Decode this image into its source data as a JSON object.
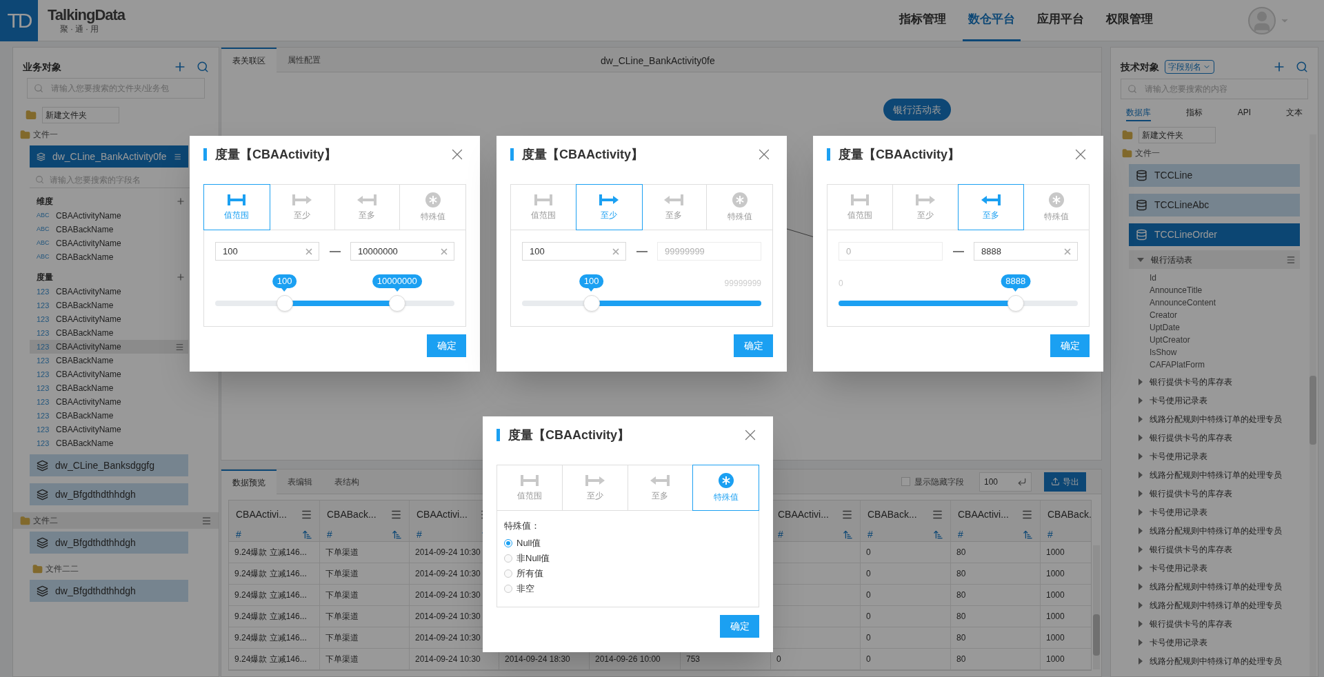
{
  "header": {
    "logo_mark": "TD",
    "brand": "TalkingData",
    "slogan": "聚·通·用",
    "nav": [
      {
        "label": "指标管理",
        "selected": false
      },
      {
        "label": "数仓平台",
        "selected": true
      },
      {
        "label": "应用平台",
        "selected": false
      },
      {
        "label": "权限管理",
        "selected": false
      }
    ]
  },
  "left_panel": {
    "title": "业务对象",
    "search": {
      "placeholder": "请输入您要搜索的文件夹/业务包"
    },
    "new_folder": {
      "value": "新建文件夹"
    },
    "folders": [
      {
        "name": "文件一",
        "hovered": false,
        "packages": [
          {
            "name": "dw_CLine_BankActivity0fe",
            "selected": true,
            "field_search": {
              "placeholder": "请输入您要搜索的字段名"
            },
            "groups": [
              {
                "title": "维度",
                "fields": [
                  {
                    "type": "ABC",
                    "name": "CBAActivityName",
                    "hovered": false
                  },
                  {
                    "type": "ABC",
                    "name": "CBABackName",
                    "hovered": false
                  },
                  {
                    "type": "ABC",
                    "name": "CBAActivityName",
                    "hovered": false
                  },
                  {
                    "type": "ABC",
                    "name": "CBABackName",
                    "hovered": false
                  }
                ]
              },
              {
                "title": "度量",
                "fields": [
                  {
                    "type": "123",
                    "name": "CBAActivityName",
                    "hovered": false
                  },
                  {
                    "type": "123",
                    "name": "CBABackName",
                    "hovered": false
                  },
                  {
                    "type": "123",
                    "name": "CBAActivityName",
                    "hovered": false
                  },
                  {
                    "type": "123",
                    "name": "CBABackName",
                    "hovered": false
                  },
                  {
                    "type": "123",
                    "name": "CBAActivityName",
                    "hovered": true
                  },
                  {
                    "type": "123",
                    "name": "CBABackName",
                    "hovered": false
                  },
                  {
                    "type": "123",
                    "name": "CBAActivityName",
                    "hovered": false
                  },
                  {
                    "type": "123",
                    "name": "CBABackName",
                    "hovered": false
                  },
                  {
                    "type": "123",
                    "name": "CBAActivityName",
                    "hovered": false
                  },
                  {
                    "type": "123",
                    "name": "CBABackName",
                    "hovered": false
                  },
                  {
                    "type": "123",
                    "name": "CBAActivityName",
                    "hovered": false
                  },
                  {
                    "type": "123",
                    "name": "CBABackName",
                    "hovered": false
                  }
                ]
              }
            ]
          },
          {
            "name": "dw_CLine_Banksdggfg",
            "selected": false
          },
          {
            "name": "dw_Bfgdthdthhdgh",
            "selected": false
          }
        ]
      },
      {
        "name": "文件二",
        "hovered": true,
        "packages": [
          {
            "name": "dw_Bfgdthdthhdgh",
            "selected": false
          }
        ],
        "children": [
          {
            "name": "文件二二",
            "hovered": false,
            "packages": [
              {
                "name": "dw_Bfgdthdthhdgh",
                "selected": false
              }
            ]
          }
        ]
      }
    ]
  },
  "center": {
    "tabs": [
      {
        "label": "表关联区",
        "selected": true
      },
      {
        "label": "属性配置",
        "selected": false
      }
    ],
    "title": "dw_CLine_BankActivity0fe",
    "nodes": [
      {
        "label": "银行活动表"
      }
    ]
  },
  "preview": {
    "tabs": [
      {
        "label": "数据预览",
        "selected": true
      },
      {
        "label": "表编辑",
        "selected": false
      },
      {
        "label": "表结构",
        "selected": false
      }
    ],
    "show_hidden": {
      "label": "显示隐藏字段",
      "checked": false
    },
    "row_count": "100",
    "export": "导出",
    "columns": [
      {
        "name": "CBAActivi...",
        "type": "#"
      },
      {
        "name": "CBABack...",
        "type": "#"
      },
      {
        "name": "CBAActivi...",
        "type": "#"
      },
      {},
      {},
      {},
      {
        "name": "CBAActivi...",
        "type": "#"
      },
      {
        "name": "CBABack...",
        "type": "#"
      },
      {
        "name": "CBAActivi...",
        "type": "#"
      },
      {
        "name": "CBABack.",
        "type": "#"
      }
    ],
    "rows": [
      [
        "9.24爆款 立减146...",
        "下单渠道",
        "2014-09-24 10:30",
        null,
        null,
        null,
        null,
        "0",
        "80",
        "1000"
      ],
      [
        "9.24爆款 立减146...",
        "下单渠道",
        "2014-09-24 10:30",
        null,
        null,
        null,
        null,
        "0",
        "80",
        "1000"
      ],
      [
        "9.24爆款 立减146...",
        "下单渠道",
        "2014-09-24 10:30",
        null,
        null,
        null,
        null,
        "0",
        "80",
        "1000"
      ],
      [
        "9.24爆款 立减146...",
        "下单渠道",
        "2014-09-24 10:30",
        null,
        null,
        null,
        null,
        "0",
        "80",
        "1000"
      ],
      [
        "9.24爆款 立减146...",
        "下单渠道",
        "2014-09-24 10:30",
        null,
        null,
        null,
        null,
        "0",
        "80",
        "1000"
      ],
      [
        "9.24爆款 立减146...",
        "下单渠道",
        "2014-09-24 10:30",
        "2014-09-24 18:30",
        "2014-09-26 10:00",
        "753",
        "0",
        "0",
        "80",
        "1000"
      ]
    ]
  },
  "right_panel": {
    "title": "技术对象",
    "alias_dropdown": "字段别名",
    "search": {
      "placeholder": "请输入您要搜索的内容"
    },
    "tabs": [
      {
        "label": "数据库",
        "selected": true
      },
      {
        "label": "指标",
        "selected": false
      },
      {
        "label": "API",
        "selected": false
      },
      {
        "label": "文本",
        "selected": false
      }
    ],
    "new_folder": {
      "value": "新建文件夹"
    },
    "folder": "文件一",
    "tables": [
      {
        "name": "TCCLine",
        "selected": false
      },
      {
        "name": "TCCLineAbc",
        "selected": false
      },
      {
        "name": "TCCLineOrder",
        "selected": true,
        "children": [
          {
            "name": "银行活动表",
            "expanded": true,
            "children": [
              {
                "name": "Id"
              },
              {
                "name": "AnnounceTitle"
              },
              {
                "name": "AnnounceContent"
              },
              {
                "name": "Creator"
              },
              {
                "name": "UptDate"
              },
              {
                "name": "UptCreator"
              },
              {
                "name": "IsShow"
              },
              {
                "name": "CAFAPlatForm"
              }
            ]
          },
          {
            "name": "银行提供卡号的库存表",
            "expanded": false
          },
          {
            "name": "卡号使用记录表",
            "expanded": false
          },
          {
            "name": "线路分配规则中特殊订单的处理专员",
            "expanded": false
          },
          {
            "name": "银行提供卡号的库存表",
            "expanded": false
          },
          {
            "name": "卡号使用记录表",
            "expanded": false
          },
          {
            "name": "线路分配规则中特殊订单的处理专员",
            "expanded": false
          },
          {
            "name": "银行提供卡号的库存表",
            "expanded": false
          },
          {
            "name": "卡号使用记录表",
            "expanded": false
          },
          {
            "name": "线路分配规则中特殊订单的处理专员",
            "expanded": false
          },
          {
            "name": "银行提供卡号的库存表",
            "expanded": false
          },
          {
            "name": "卡号使用记录表",
            "expanded": false
          },
          {
            "name": "线路分配规则中特殊订单的处理专员",
            "expanded": false
          },
          {
            "name": "线路分配规则中特殊订单的处理专员",
            "expanded": false
          },
          {
            "name": "银行提供卡号的库存表",
            "expanded": false
          },
          {
            "name": "卡号使用记录表",
            "expanded": false
          },
          {
            "name": "线路分配规则中特殊订单的处理专员",
            "expanded": false
          }
        ]
      }
    ]
  },
  "dialogs": [
    {
      "title": "度量【CBAActivity】",
      "kind": "range",
      "tabs": [
        {
          "kind": "range",
          "label": "值范围",
          "selected": true
        },
        {
          "kind": "min",
          "label": "至少",
          "selected": false
        },
        {
          "kind": "max",
          "label": "至多",
          "selected": false
        },
        {
          "kind": "special",
          "label": "特殊值",
          "selected": false
        }
      ],
      "inputs": [
        {
          "value": "100",
          "disabled": false
        },
        {
          "value": "10000000",
          "disabled": false
        }
      ],
      "handles": [
        {
          "level": 0.29,
          "reading": "100"
        },
        {
          "level": 0.76,
          "reading": "10000000"
        }
      ],
      "confirm": "确定"
    },
    {
      "title": "度量【CBAActivity】",
      "kind": "min",
      "tabs": [
        {
          "kind": "range",
          "label": "值范围",
          "selected": false
        },
        {
          "kind": "min",
          "label": "至少",
          "selected": true
        },
        {
          "kind": "max",
          "label": "至多",
          "selected": false
        },
        {
          "kind": "special",
          "label": "特殊值",
          "selected": false
        }
      ],
      "inputs": [
        {
          "value": "100",
          "disabled": false
        },
        {
          "placeholder": "99999999",
          "disabled": true
        }
      ],
      "handles": [
        {
          "level": 0.29,
          "reading": "100"
        }
      ],
      "end_label": "99999999",
      "confirm": "确定"
    },
    {
      "title": "度量【CBAActivity】",
      "kind": "max",
      "tabs": [
        {
          "kind": "range",
          "label": "值范围",
          "selected": false
        },
        {
          "kind": "min",
          "label": "至少",
          "selected": false
        },
        {
          "kind": "max",
          "label": "至多",
          "selected": true
        },
        {
          "kind": "special",
          "label": "特殊值",
          "selected": false
        }
      ],
      "inputs": [
        {
          "placeholder": "0",
          "disabled": true
        },
        {
          "value": "8888",
          "disabled": false
        }
      ],
      "handles": [
        {
          "level": 0.74,
          "reading": "8888"
        }
      ],
      "start_label": "0",
      "confirm": "确定"
    },
    {
      "title": "度量【CBAActivity】",
      "kind": "special",
      "tabs": [
        {
          "kind": "range",
          "label": "值范围",
          "selected": false
        },
        {
          "kind": "min",
          "label": "至少",
          "selected": false
        },
        {
          "kind": "max",
          "label": "至多",
          "selected": false
        },
        {
          "kind": "special",
          "label": "特殊值",
          "selected": true
        }
      ],
      "label": "特殊值：",
      "options": [
        {
          "label": "Null值",
          "selected": true
        },
        {
          "label": "非Null值",
          "selected": false
        },
        {
          "label": "所有值",
          "selected": false
        },
        {
          "label": "非空",
          "selected": false
        }
      ],
      "confirm": "确定"
    }
  ]
}
